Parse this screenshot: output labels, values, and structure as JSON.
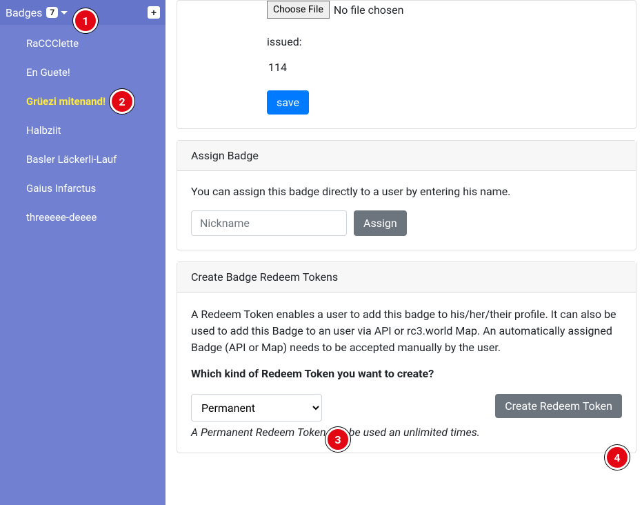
{
  "sidebar": {
    "title": "Badges",
    "count": "7",
    "add_label": "+",
    "items": [
      {
        "label": "RaCCClette"
      },
      {
        "label": "En Guete!"
      },
      {
        "label": "Grüezi mitenand!"
      },
      {
        "label": "Halbziit"
      },
      {
        "label": "Basler Läckerli-Lauf"
      },
      {
        "label": "Gaius Infarctus"
      },
      {
        "label": "threeeee-deeee"
      }
    ],
    "active_index": 2
  },
  "top_card": {
    "choose_file_label": "Choose File",
    "no_file_text": "No file chosen",
    "issued_label": "issued:",
    "issued_value": "114",
    "save_label": "save"
  },
  "assign_card": {
    "header": "Assign Badge",
    "description": "You can assign this badge directly to a user by entering his name.",
    "nickname_placeholder": "Nickname",
    "assign_label": "Assign"
  },
  "redeem_card": {
    "header": "Create Badge Redeem Tokens",
    "description": "A Redeem Token enables a user to add this badge to his/her/their profile. It can also be used to add this Badge to an user via API or rc3.world Map. An automatically assigned Badge (API or Map) needs to be accepted manually by the user.",
    "question": "Which kind of Redeem Token you want to create?",
    "select_value": "Permanent",
    "create_label": "Create Redeem Token",
    "hint": "A Permanent Redeem Token can be used an unlimited times."
  },
  "callouts": {
    "c1": "1",
    "c2": "2",
    "c3": "3",
    "c4": "4"
  }
}
